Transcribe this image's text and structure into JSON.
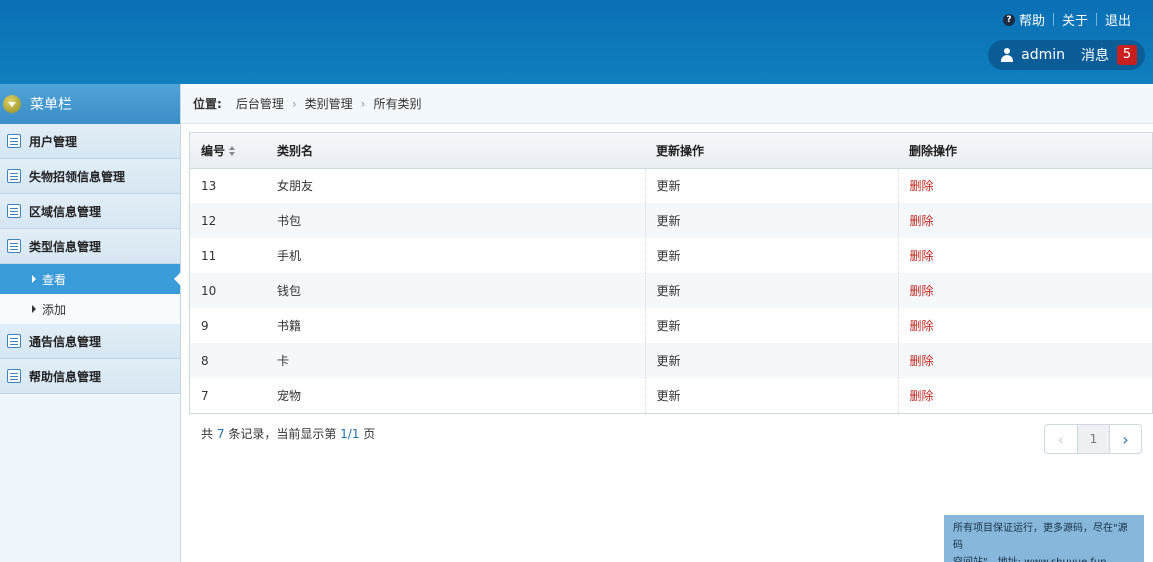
{
  "header": {
    "help": "帮助",
    "about": "关于",
    "logout": "退出",
    "username": "admin",
    "messages_label": "消息",
    "messages_count": "5"
  },
  "sidebar": {
    "title": "菜单栏",
    "items": [
      {
        "label": "用户管理"
      },
      {
        "label": "失物招领信息管理"
      },
      {
        "label": "区域信息管理"
      },
      {
        "label": "类型信息管理"
      },
      {
        "label": "通告信息管理"
      },
      {
        "label": "帮助信息管理"
      }
    ],
    "sub_items": [
      {
        "label": "查看",
        "active": true
      },
      {
        "label": "添加",
        "active": false
      }
    ]
  },
  "breadcrumb": {
    "label": "位置:",
    "crumbs": [
      "后台管理",
      "类别管理",
      "所有类别"
    ]
  },
  "table": {
    "headers": [
      "编号",
      "类别名",
      "更新操作",
      "删除操作"
    ],
    "rows": [
      {
        "id": "13",
        "name": "女朋友",
        "update": "更新",
        "delete": "删除"
      },
      {
        "id": "12",
        "name": "书包",
        "update": "更新",
        "delete": "删除"
      },
      {
        "id": "11",
        "name": "手机",
        "update": "更新",
        "delete": "删除"
      },
      {
        "id": "10",
        "name": "钱包",
        "update": "更新",
        "delete": "删除"
      },
      {
        "id": "9",
        "name": "书籍",
        "update": "更新",
        "delete": "删除"
      },
      {
        "id": "8",
        "name": "卡",
        "update": "更新",
        "delete": "删除"
      },
      {
        "id": "7",
        "name": "宠物",
        "update": "更新",
        "delete": "删除"
      }
    ]
  },
  "footer": {
    "prefix": "共",
    "total": "7",
    "mid": "条记录，当前显示第",
    "page": "1/1",
    "suffix": "页"
  },
  "pager": {
    "prev": "‹",
    "current": "1",
    "next": "›"
  },
  "notice": {
    "line1": "所有项目保证运行，更多源码，尽在\"源码",
    "line2": "空间站\"，地址: www.shuyue.fun"
  },
  "colors": {
    "header": "#0c76b9",
    "sidebar_active": "#3a9bd9",
    "delete_link": "#c0271e",
    "badge": "#c9201f"
  }
}
